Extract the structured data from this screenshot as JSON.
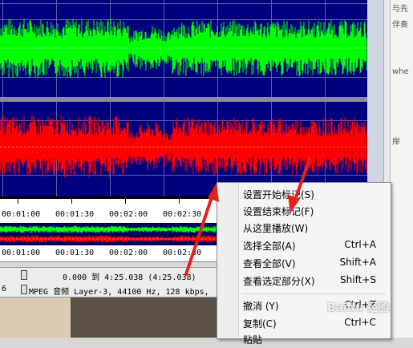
{
  "colors": {
    "wave_bg": "#00007f",
    "left_channel": "#00ff00",
    "right_channel": "#ff0000",
    "arrow": "#e8201a"
  },
  "timeline": {
    "ticks": [
      "00:01:00",
      "00:01:30",
      "00:02:00",
      "00:02:30"
    ]
  },
  "timeline_overview": {
    "ticks": [
      "00:01:00",
      "00:01:30",
      "00:02:00",
      "00:02:30"
    ]
  },
  "status": {
    "range_text": "0.000 到 4:25.038 (4:25.038)",
    "format_text": "MPEG 音频 Layer-3, 44100 Hz, 128 kbps,",
    "row_prefix": "6"
  },
  "side_text": [
    "与先",
    "伴奏",
    "whe",
    "岸"
  ],
  "context_menu": {
    "items": [
      {
        "label": "设置开始标记(S)",
        "shortcut": "",
        "enabled": true
      },
      {
        "label": "设置结束标记(F)",
        "shortcut": "",
        "enabled": true
      },
      {
        "label": "从这里播放(W)",
        "shortcut": "",
        "enabled": true
      },
      {
        "label": "选择全部(A)",
        "shortcut": "Ctrl+A",
        "enabled": false
      },
      {
        "label": "查看全部(V)",
        "shortcut": "Shift+A",
        "enabled": false
      },
      {
        "label": "查看选定部分(X)",
        "shortcut": "Shift+S",
        "enabled": false
      },
      {
        "label": "撤消 (Y)",
        "shortcut": "Ctrl+Z",
        "enabled": false
      },
      {
        "label": "复制(C)",
        "shortcut": "Ctrl+C",
        "enabled": true
      },
      {
        "label": "粘贴",
        "shortcut": "",
        "enabled": true
      }
    ]
  },
  "watermark": "Baidu 经验"
}
